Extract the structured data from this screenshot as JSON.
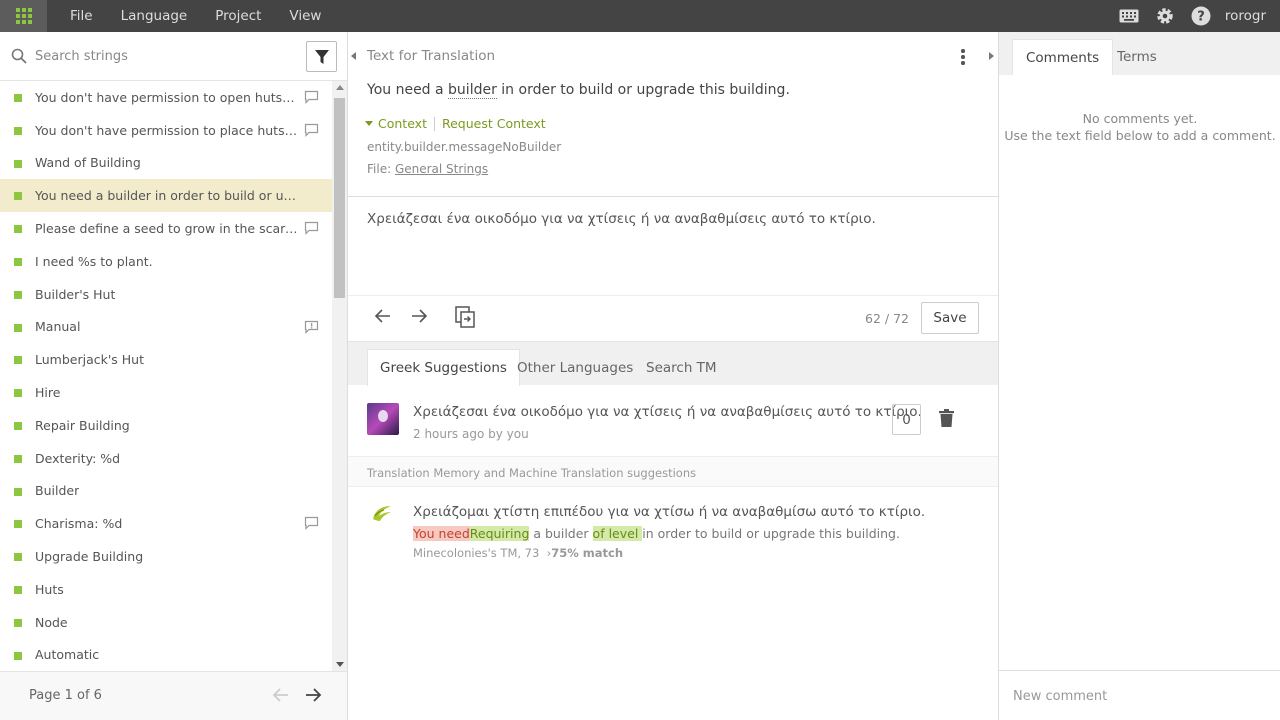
{
  "topbar": {
    "menu": [
      "File",
      "Language",
      "Project",
      "View"
    ],
    "username": "rorogr"
  },
  "sidebar": {
    "search_placeholder": "Search strings",
    "items": [
      {
        "text": "You don't have permission to open huts in %s.",
        "badge": "comment"
      },
      {
        "text": "You don't have permission to place huts in %s.",
        "badge": "comment"
      },
      {
        "text": "Wand of Building",
        "badge": ""
      },
      {
        "text": "You need a builder in order to build or upgrade this building.",
        "badge": "",
        "active": true
      },
      {
        "text": "Please define a seed to grow in the scarecrow.",
        "badge": "comment"
      },
      {
        "text": "I need %s to plant.",
        "badge": ""
      },
      {
        "text": "Builder's Hut",
        "badge": ""
      },
      {
        "text": "Manual",
        "badge": "issue"
      },
      {
        "text": "Lumberjack's Hut",
        "badge": ""
      },
      {
        "text": "Hire",
        "badge": ""
      },
      {
        "text": "Repair Building",
        "badge": ""
      },
      {
        "text": "Dexterity: %d",
        "badge": ""
      },
      {
        "text": "Builder",
        "badge": ""
      },
      {
        "text": "Charisma: %d",
        "badge": "comment"
      },
      {
        "text": "Upgrade Building",
        "badge": ""
      },
      {
        "text": "Huts",
        "badge": ""
      },
      {
        "text": "Node",
        "badge": ""
      },
      {
        "text": "Automatic",
        "badge": ""
      }
    ],
    "pager": "Page 1 of 6",
    "status_color": "#8dc63f"
  },
  "editor": {
    "header": "Text for Translation",
    "source_before": "You need a ",
    "source_term": "builder",
    "source_after": " in order to build or upgrade this building.",
    "context_label": "Context",
    "request_context": "Request Context",
    "key": "entity.builder.messageNoBuilder",
    "file_label": "File:",
    "file_name": "General Strings",
    "translation": "Χρειάζεσαι ένα οικοδόμο για να χτίσεις ή να αναβαθμίσεις αυτό το κτίριο.",
    "counter": "62 / 72",
    "save": "Save"
  },
  "suggestions": {
    "tabs": [
      "Greek Suggestions",
      "Other Languages",
      "Search TM"
    ],
    "items": [
      {
        "text": "Χρειάζεσαι ένα οικοδόμο για να χτίσεις ή να αναβαθμίσεις αυτό το κτίριο.",
        "meta": "2 hours ago by you",
        "votes": "0"
      }
    ],
    "tm_header": "Translation Memory and Machine Translation suggestions",
    "tm": {
      "text": "Χρειάζομαι χτίστη επιπέδου  για να χτίσω ή να αναβαθμίσω αυτό το κτίριο.",
      "diff_del": "You need",
      "diff_ins1": "Requiring",
      "diff_mid": " a builder ",
      "diff_ins2": "of level ",
      "diff_end": " in order to build or upgrade this building.",
      "meta_source": "Minecolonies's TM, 73",
      "meta_match": "75% match"
    }
  },
  "comments": {
    "tabs": [
      "Comments",
      "Terms"
    ],
    "empty_line1": "No comments yet.",
    "empty_line2": "Use the text field below to add a comment.",
    "new_comment_placeholder": "New comment"
  }
}
